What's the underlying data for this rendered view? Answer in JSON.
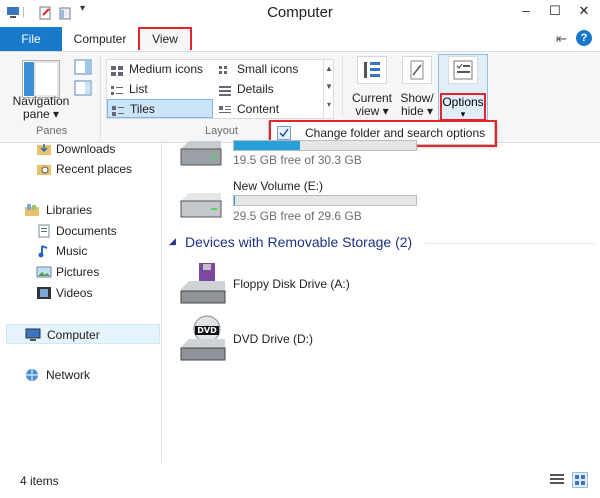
{
  "window": {
    "title": "Computer",
    "controls": {
      "minimize": "–",
      "maximize": "☐",
      "close": "✕"
    }
  },
  "ribbon": {
    "tabs": {
      "file": "File",
      "computer": "Computer",
      "view": "View"
    },
    "panes": {
      "navigation_pane_line1": "Navigation",
      "navigation_pane_line2": "pane",
      "group_label": "Panes"
    },
    "layout": {
      "group_label": "Layout",
      "items": [
        "Medium icons",
        "Small icons",
        "List",
        "Details",
        "Tiles",
        "Content"
      ]
    },
    "current_view": {
      "line1": "Current",
      "line2": "view"
    },
    "show_hide": {
      "line1": "Show/",
      "line2": "hide"
    },
    "options": {
      "label": "Options"
    },
    "options_menu": {
      "item": "Change folder and search options"
    }
  },
  "navigation": {
    "items": [
      "Downloads",
      "Recent places",
      "Libraries",
      "Documents",
      "Music",
      "Pictures",
      "Videos",
      "Computer",
      "Network"
    ]
  },
  "content": {
    "hard_disks": [
      {
        "name": "",
        "free_text": "19.5 GB free of 30.3 GB",
        "used_fraction": 0.36
      },
      {
        "name": "New Volume (E:)",
        "free_text": "29.5 GB free of 29.6 GB",
        "used_fraction": 0.003
      }
    ],
    "removable_header": "Devices with Removable Storage (2)",
    "removable_devices": [
      {
        "name": "Floppy Disk Drive (A:)"
      },
      {
        "name": "DVD Drive (D:)"
      }
    ]
  },
  "status": {
    "item_count": "4 items"
  },
  "colors": {
    "accent": "#1979ca",
    "highlight_box": "#e3242b",
    "section_header": "#1e3287",
    "drive_bar": "#26a0da"
  }
}
